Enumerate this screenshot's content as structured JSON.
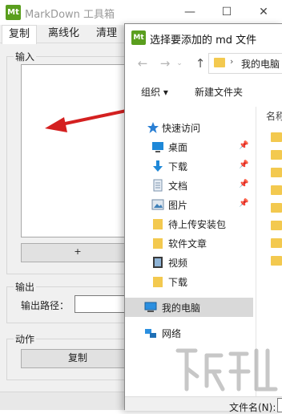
{
  "app": {
    "icon_text": "Mt",
    "title": "MarkDown 工具箱",
    "controls": {
      "minimize": "—",
      "maximize": "☐",
      "close": "✕"
    },
    "tabs": [
      {
        "label": "复制"
      },
      {
        "label": "离线化"
      },
      {
        "label": "清理"
      }
    ],
    "input_group": {
      "title": "输入",
      "add_label": "+"
    },
    "output_group": {
      "title": "输出",
      "path_label": "输出路径：",
      "path_value": ""
    },
    "action_group": {
      "title": "动作",
      "copy_label": "复制"
    }
  },
  "dialog": {
    "icon_text": "Mt",
    "title": "选择要添加的 md 文件",
    "nav": {
      "back": "←",
      "forward": "→",
      "recent": "⌄",
      "up": "↑"
    },
    "address": {
      "chevron": "›",
      "text": "我的电脑"
    },
    "toolbar": {
      "organize": "组织 ▾",
      "new_folder": "新建文件夹"
    },
    "sidebar": [
      {
        "label": "快速访问",
        "icon": "star-icon"
      },
      {
        "label": "桌面",
        "icon": "desktop-icon",
        "pinned": true
      },
      {
        "label": "下载",
        "icon": "download-icon",
        "pinned": true
      },
      {
        "label": "文档",
        "icon": "document-icon",
        "pinned": true
      },
      {
        "label": "图片",
        "icon": "picture-icon",
        "pinned": true
      },
      {
        "label": "待上传安装包",
        "icon": "folder-icon"
      },
      {
        "label": "软件文章",
        "icon": "folder-icon"
      },
      {
        "label": "视频",
        "icon": "video-icon"
      },
      {
        "label": "下载",
        "icon": "folder-icon"
      },
      {
        "label": "我的电脑",
        "icon": "computer-icon",
        "selected": true
      },
      {
        "label": "网络",
        "icon": "network-icon"
      }
    ],
    "content": {
      "column_name": "名称"
    },
    "filename_label": "文件名(N):",
    "filename_value": ""
  },
  "colors": {
    "logo_green": "#5a9e1e",
    "folder_yellow": "#f3c94f",
    "arrow_red": "#d42020",
    "selected_bg": "#d9d9d9"
  }
}
